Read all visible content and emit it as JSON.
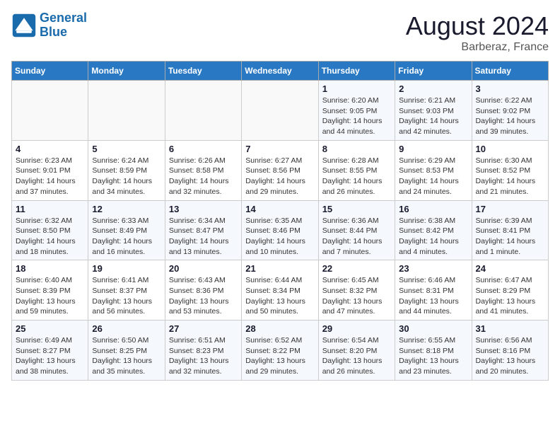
{
  "header": {
    "logo_line1": "General",
    "logo_line2": "Blue",
    "month_title": "August 2024",
    "location": "Barberaz, France"
  },
  "weekdays": [
    "Sunday",
    "Monday",
    "Tuesday",
    "Wednesday",
    "Thursday",
    "Friday",
    "Saturday"
  ],
  "weeks": [
    [
      {
        "day": "",
        "info": ""
      },
      {
        "day": "",
        "info": ""
      },
      {
        "day": "",
        "info": ""
      },
      {
        "day": "",
        "info": ""
      },
      {
        "day": "1",
        "info": "Sunrise: 6:20 AM\nSunset: 9:05 PM\nDaylight: 14 hours\nand 44 minutes."
      },
      {
        "day": "2",
        "info": "Sunrise: 6:21 AM\nSunset: 9:03 PM\nDaylight: 14 hours\nand 42 minutes."
      },
      {
        "day": "3",
        "info": "Sunrise: 6:22 AM\nSunset: 9:02 PM\nDaylight: 14 hours\nand 39 minutes."
      }
    ],
    [
      {
        "day": "4",
        "info": "Sunrise: 6:23 AM\nSunset: 9:01 PM\nDaylight: 14 hours\nand 37 minutes."
      },
      {
        "day": "5",
        "info": "Sunrise: 6:24 AM\nSunset: 8:59 PM\nDaylight: 14 hours\nand 34 minutes."
      },
      {
        "day": "6",
        "info": "Sunrise: 6:26 AM\nSunset: 8:58 PM\nDaylight: 14 hours\nand 32 minutes."
      },
      {
        "day": "7",
        "info": "Sunrise: 6:27 AM\nSunset: 8:56 PM\nDaylight: 14 hours\nand 29 minutes."
      },
      {
        "day": "8",
        "info": "Sunrise: 6:28 AM\nSunset: 8:55 PM\nDaylight: 14 hours\nand 26 minutes."
      },
      {
        "day": "9",
        "info": "Sunrise: 6:29 AM\nSunset: 8:53 PM\nDaylight: 14 hours\nand 24 minutes."
      },
      {
        "day": "10",
        "info": "Sunrise: 6:30 AM\nSunset: 8:52 PM\nDaylight: 14 hours\nand 21 minutes."
      }
    ],
    [
      {
        "day": "11",
        "info": "Sunrise: 6:32 AM\nSunset: 8:50 PM\nDaylight: 14 hours\nand 18 minutes."
      },
      {
        "day": "12",
        "info": "Sunrise: 6:33 AM\nSunset: 8:49 PM\nDaylight: 14 hours\nand 16 minutes."
      },
      {
        "day": "13",
        "info": "Sunrise: 6:34 AM\nSunset: 8:47 PM\nDaylight: 14 hours\nand 13 minutes."
      },
      {
        "day": "14",
        "info": "Sunrise: 6:35 AM\nSunset: 8:46 PM\nDaylight: 14 hours\nand 10 minutes."
      },
      {
        "day": "15",
        "info": "Sunrise: 6:36 AM\nSunset: 8:44 PM\nDaylight: 14 hours\nand 7 minutes."
      },
      {
        "day": "16",
        "info": "Sunrise: 6:38 AM\nSunset: 8:42 PM\nDaylight: 14 hours\nand 4 minutes."
      },
      {
        "day": "17",
        "info": "Sunrise: 6:39 AM\nSunset: 8:41 PM\nDaylight: 14 hours\nand 1 minute."
      }
    ],
    [
      {
        "day": "18",
        "info": "Sunrise: 6:40 AM\nSunset: 8:39 PM\nDaylight: 13 hours\nand 59 minutes."
      },
      {
        "day": "19",
        "info": "Sunrise: 6:41 AM\nSunset: 8:37 PM\nDaylight: 13 hours\nand 56 minutes."
      },
      {
        "day": "20",
        "info": "Sunrise: 6:43 AM\nSunset: 8:36 PM\nDaylight: 13 hours\nand 53 minutes."
      },
      {
        "day": "21",
        "info": "Sunrise: 6:44 AM\nSunset: 8:34 PM\nDaylight: 13 hours\nand 50 minutes."
      },
      {
        "day": "22",
        "info": "Sunrise: 6:45 AM\nSunset: 8:32 PM\nDaylight: 13 hours\nand 47 minutes."
      },
      {
        "day": "23",
        "info": "Sunrise: 6:46 AM\nSunset: 8:31 PM\nDaylight: 13 hours\nand 44 minutes."
      },
      {
        "day": "24",
        "info": "Sunrise: 6:47 AM\nSunset: 8:29 PM\nDaylight: 13 hours\nand 41 minutes."
      }
    ],
    [
      {
        "day": "25",
        "info": "Sunrise: 6:49 AM\nSunset: 8:27 PM\nDaylight: 13 hours\nand 38 minutes."
      },
      {
        "day": "26",
        "info": "Sunrise: 6:50 AM\nSunset: 8:25 PM\nDaylight: 13 hours\nand 35 minutes."
      },
      {
        "day": "27",
        "info": "Sunrise: 6:51 AM\nSunset: 8:23 PM\nDaylight: 13 hours\nand 32 minutes."
      },
      {
        "day": "28",
        "info": "Sunrise: 6:52 AM\nSunset: 8:22 PM\nDaylight: 13 hours\nand 29 minutes."
      },
      {
        "day": "29",
        "info": "Sunrise: 6:54 AM\nSunset: 8:20 PM\nDaylight: 13 hours\nand 26 minutes."
      },
      {
        "day": "30",
        "info": "Sunrise: 6:55 AM\nSunset: 8:18 PM\nDaylight: 13 hours\nand 23 minutes."
      },
      {
        "day": "31",
        "info": "Sunrise: 6:56 AM\nSunset: 8:16 PM\nDaylight: 13 hours\nand 20 minutes."
      }
    ]
  ]
}
